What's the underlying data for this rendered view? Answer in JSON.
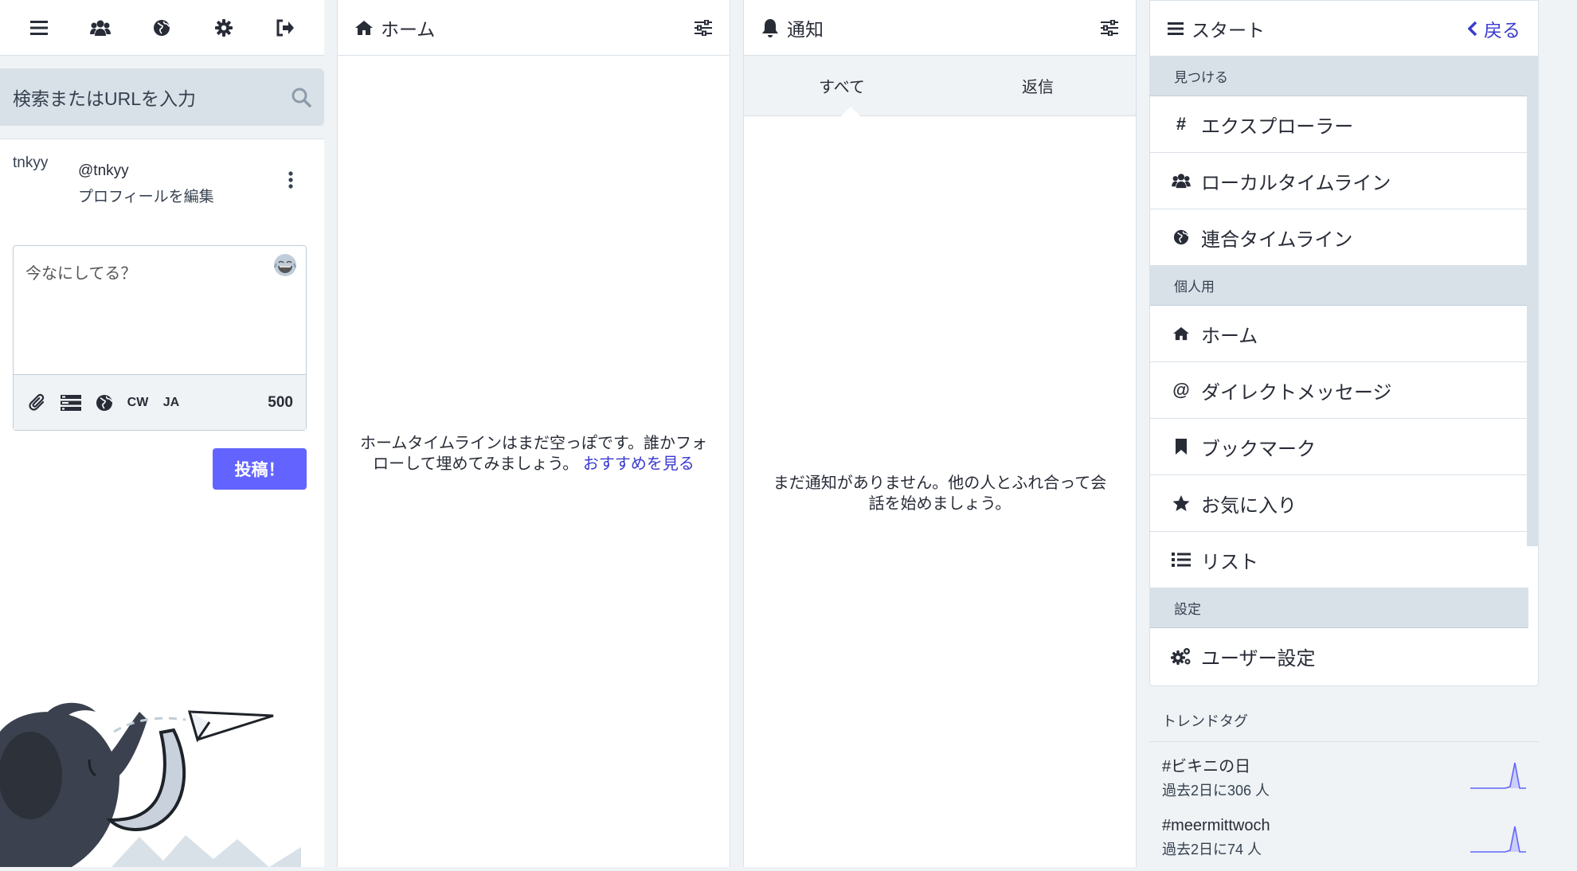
{
  "compose": {
    "nav_icons": [
      "menu-icon",
      "users-icon",
      "globe-icon",
      "gear-icon",
      "logout-icon"
    ],
    "search": {
      "placeholder": "検索またはURLを入力"
    },
    "account": {
      "avatar_alt": "tnkyy",
      "handle": "@tnkyy",
      "edit_profile": "プロフィールを編集"
    },
    "composer": {
      "placeholder": "今なにしてる？",
      "cw_label": "CW",
      "lang_label": "JA",
      "counter": "500"
    },
    "post_button": "投稿！"
  },
  "home": {
    "title": "ホーム",
    "empty_text": "ホームタイムラインはまだ空っぽです。誰かフォローして埋めてみましょう。",
    "empty_link": "おすすめを見る"
  },
  "notifications": {
    "title": "通知",
    "tabs": [
      {
        "label": "すべて",
        "active": true
      },
      {
        "label": "返信",
        "active": false
      }
    ],
    "empty_text": "まだ通知がありません。他の人とふれ合って会話を始めましょう。"
  },
  "start": {
    "title": "スタート",
    "back_label": "戻る",
    "sections": [
      {
        "header": "見つける",
        "items": [
          {
            "label": "エクスプローラー",
            "icon": "hashtag-icon"
          },
          {
            "label": "ローカルタイムライン",
            "icon": "users-icon"
          },
          {
            "label": "連合タイムライン",
            "icon": "globe-icon"
          }
        ]
      },
      {
        "header": "個人用",
        "items": [
          {
            "label": "ホーム",
            "icon": "home-icon"
          },
          {
            "label": "ダイレクトメッセージ",
            "icon": "at-icon"
          },
          {
            "label": "ブックマーク",
            "icon": "bookmark-icon"
          },
          {
            "label": "お気に入り",
            "icon": "star-icon"
          },
          {
            "label": "リスト",
            "icon": "list-icon"
          }
        ]
      },
      {
        "header": "設定",
        "items": [
          {
            "label": "ユーザー設定",
            "icon": "gears-icon"
          }
        ]
      }
    ],
    "trends": {
      "header": "トレンドタグ",
      "items": [
        {
          "tag": "#ビキニの日",
          "uses": "過去2日に306 人"
        },
        {
          "tag": "#meermittwoch",
          "uses": "過去2日に74 人"
        }
      ]
    }
  },
  "colors": {
    "accent": "#6364ff",
    "link": "#3a3bcf",
    "border": "#d9e1e8",
    "background": "#eff3f5"
  }
}
